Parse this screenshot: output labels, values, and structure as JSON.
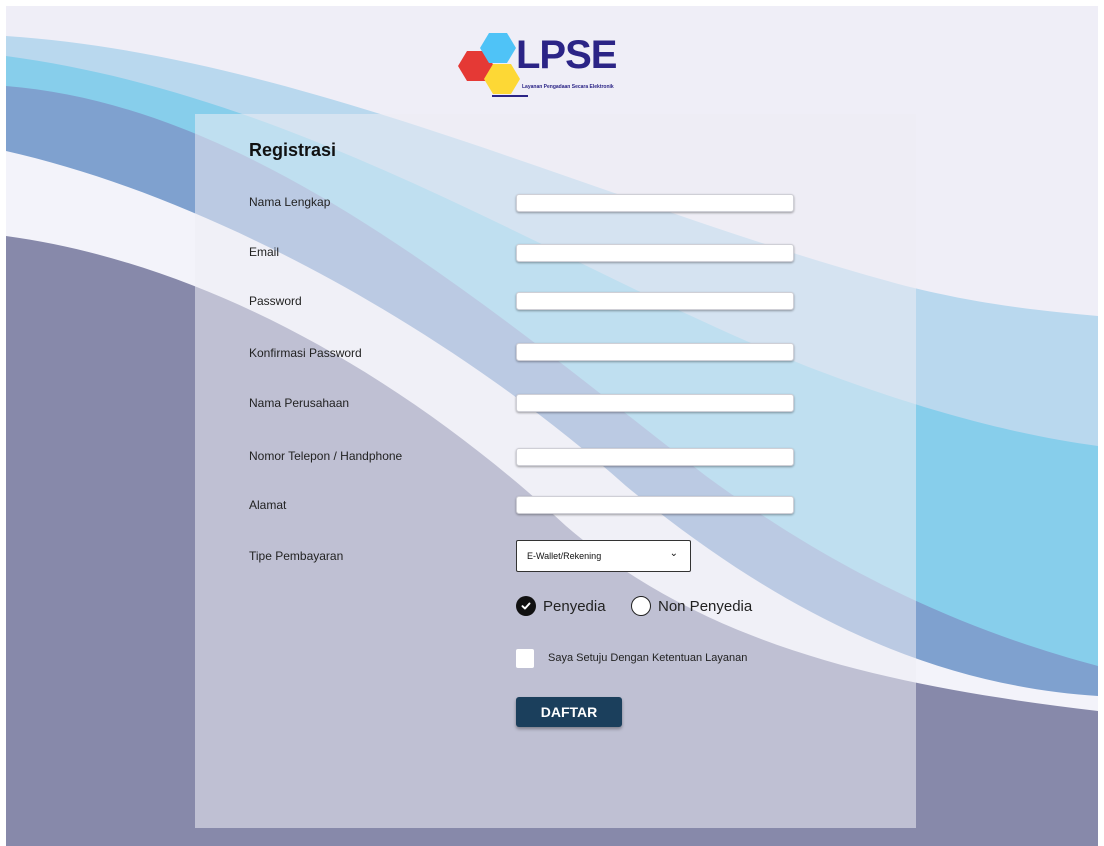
{
  "brand": {
    "logo_text": "LPSE",
    "logo_subtitle": "Layanan Pengadaan Secara Elektronik"
  },
  "form": {
    "title": "Registrasi",
    "fields": [
      {
        "label": "Nama Lengkap",
        "value": ""
      },
      {
        "label": "Email",
        "value": ""
      },
      {
        "label": "Password",
        "value": ""
      },
      {
        "label": "Konfirmasi Password",
        "value": ""
      },
      {
        "label": "Nama Perusahaan",
        "value": ""
      },
      {
        "label": "Nomor Telepon / Handphone",
        "value": ""
      },
      {
        "label": "Alamat",
        "value": ""
      }
    ],
    "payment": {
      "label": "Tipe Pembayaran",
      "selected": "E-Wallet/Rekening"
    },
    "role_options": [
      {
        "label": "Penyedia",
        "selected": true
      },
      {
        "label": "Non Penyedia",
        "selected": false
      }
    ],
    "agreement": {
      "label": "Saya Setuju Dengan Ketentuan Layanan",
      "checked": false
    },
    "submit_label": "DAFTAR"
  },
  "colors": {
    "background": "#efeef7",
    "wave_dark": "#8789aa",
    "wave_mid": "#7fa1cf",
    "wave_light": "#87ceeb",
    "button": "#1b3f5c",
    "logo_text": "#2b2486"
  }
}
